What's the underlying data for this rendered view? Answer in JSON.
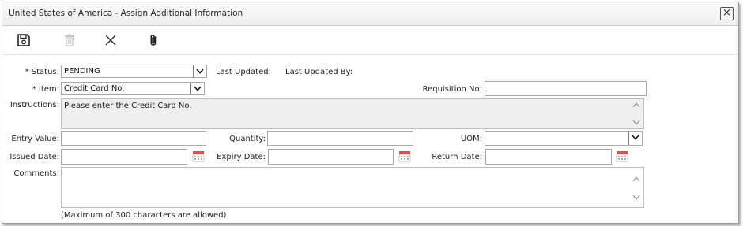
{
  "dialog": {
    "title": "United States of America - Assign Additional Information",
    "close_glyph": "×"
  },
  "toolbar": {
    "save": "save-icon",
    "delete": "trash-icon",
    "cancel": "close-icon",
    "attach": "paperclip-icon"
  },
  "form": {
    "status_label": "* Status:",
    "status_value": "PENDING",
    "last_updated_label": "Last Updated:",
    "last_updated_by_label": "Last Updated By:",
    "item_label": "* Item:",
    "item_value": "Credit Card No.",
    "requisition_label": "Requisition No:",
    "requisition_value": "",
    "instructions_label": "Instructions:",
    "instructions_value": "Please enter the Credit Card No.",
    "entry_value_label": "Entry Value:",
    "entry_value": "",
    "quantity_label": "Quantity:",
    "quantity_value": "",
    "uom_label": "UOM:",
    "uom_value": "",
    "issued_date_label": "Issued Date:",
    "issued_date_value": "",
    "expiry_date_label": "Expiry Date:",
    "expiry_date_value": "",
    "return_date_label": "Return Date:",
    "return_date_value": "",
    "comments_label": "Comments:",
    "comments_value": "",
    "comments_hint": "(Maximum of 300 characters are allowed)"
  },
  "colors": {
    "calendar_red": "#d9534f",
    "disabled_area": "#efefef"
  }
}
